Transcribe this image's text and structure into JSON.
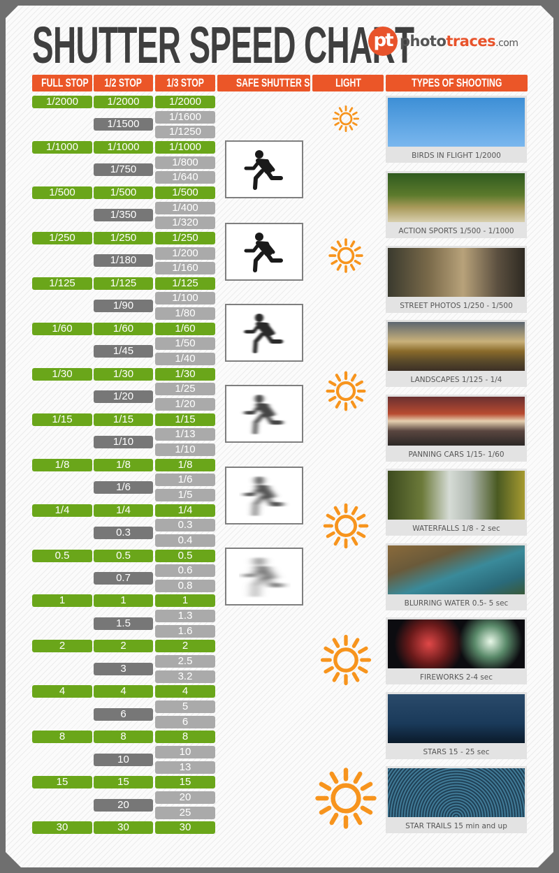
{
  "title": "SHUTTER SPEED CHART",
  "logo": {
    "badge": "pt",
    "name_part1": "photo",
    "name_part2": "traces",
    "domain": ".com"
  },
  "headers": [
    "FULL STOP",
    "1/2 STOP",
    "1/3 STOP",
    "SAFE SHUTTER SPEED",
    "LIGHT",
    "TYPES OF SHOOTING"
  ],
  "colors": {
    "full_stop": "#6aa61a",
    "half_stop": "#777777",
    "third_stop": "#aaaaaa",
    "header": "#eb5628",
    "sun": "#f7941d"
  },
  "chart_data": {
    "type": "table",
    "title": "SHUTTER SPEED CHART",
    "full_stop": [
      "1/2000",
      "1/1000",
      "1/500",
      "1/250",
      "1/125",
      "1/60",
      "1/30",
      "1/15",
      "1/8",
      "1/4",
      "0.5",
      "1",
      "2",
      "4",
      "8",
      "15",
      "30"
    ],
    "half_stop": [
      "1/2000",
      "1/1500",
      "1/1000",
      "1/750",
      "1/500",
      "1/350",
      "1/250",
      "1/180",
      "1/125",
      "1/90",
      "1/60",
      "1/45",
      "1/30",
      "1/20",
      "1/15",
      "1/10",
      "1/8",
      "1/6",
      "1/4",
      "0.3",
      "0.5",
      "0.7",
      "1",
      "1.5",
      "2",
      "3",
      "4",
      "6",
      "8",
      "10",
      "15",
      "20",
      "30"
    ],
    "third_stop": [
      "1/2000",
      "1/1600",
      "1/1250",
      "1/1000",
      "1/800",
      "1/640",
      "1/500",
      "1/400",
      "1/320",
      "1/250",
      "1/200",
      "1/160",
      "1/125",
      "1/100",
      "1/80",
      "1/60",
      "1/50",
      "1/40",
      "1/30",
      "1/25",
      "1/20",
      "1/15",
      "1/13",
      "1/10",
      "1/8",
      "1/6",
      "1/5",
      "1/4",
      "0.3",
      "0.4",
      "0.5",
      "0.6",
      "0.8",
      "1",
      "1.3",
      "1.6",
      "2",
      "2.5",
      "3.2",
      "4",
      "5",
      "6",
      "8",
      "10",
      "13",
      "15",
      "20",
      "25",
      "30"
    ],
    "safe_shutter_speed_levels": [
      "sharp",
      "sharp",
      "slight-blur",
      "moderate-blur",
      "strong-blur",
      "heavy-blur"
    ],
    "light_levels": [
      1,
      2,
      3,
      4,
      5,
      6
    ],
    "types_of_shooting": [
      {
        "label": "BIRDS IN FLIGHT 1/2000",
        "image": "bird-in-flight"
      },
      {
        "label": "ACTION SPORTS 1/500 - 1/1000",
        "image": "mountain-biker"
      },
      {
        "label": "STREET PHOTOS 1/250 - 1/500",
        "image": "street-cafe"
      },
      {
        "label": "LANDSCAPES 1/125 - 1/4",
        "image": "landscape-road"
      },
      {
        "label": "PANNING CARS 1/15- 1/60",
        "image": "yellow-taxi"
      },
      {
        "label": "WATERFALLS 1/8 - 2 sec",
        "image": "waterfall"
      },
      {
        "label": "BLURRING WATER 0.5- 5 sec",
        "image": "coastal-cove"
      },
      {
        "label": "FIREWORKS  2-4 sec",
        "image": "fireworks"
      },
      {
        "label": "STARS  15 - 25 sec",
        "image": "night-sky"
      },
      {
        "label": "STAR TRAILS  15 min and up",
        "image": "star-trails"
      }
    ]
  }
}
